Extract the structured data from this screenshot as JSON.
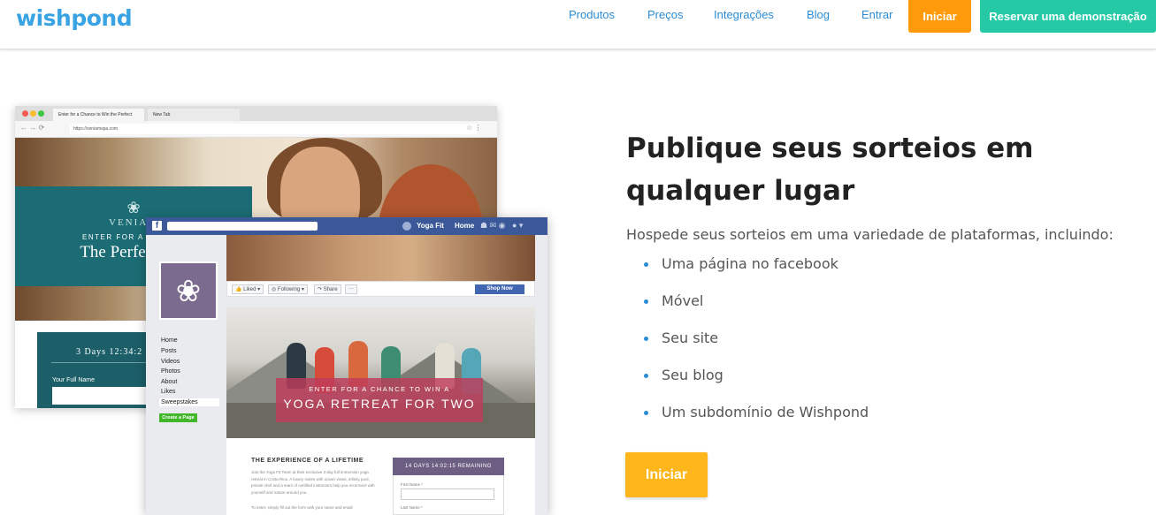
{
  "header": {
    "logo": "wishpond",
    "nav": [
      "Produtos",
      "Preços",
      "Integrações",
      "Blog",
      "Entrar"
    ],
    "start_label": "Iniciar",
    "demo_label": "Reservar uma demonstração"
  },
  "mockup": {
    "browser": {
      "tab1": "Enter for a Chance to Win the Perfect",
      "tab2": "New Tab",
      "url": "https://veniamspa.com",
      "brand": "VENIAM",
      "kicker": "ENTER FOR A CHANCE",
      "headline": "The Perfect Spa",
      "timer": "3 Days 12:34:2",
      "field": "Your Full Name"
    },
    "facebook": {
      "page_name": "Yoga Fit",
      "home": "Home",
      "menu": [
        "Home",
        "Posts",
        "Videos",
        "Photos",
        "About",
        "Likes",
        "Sweepstakes"
      ],
      "create_page": "Create a Page",
      "liked": "Liked",
      "following": "Following",
      "share": "Share",
      "shop": "Shop Now",
      "banner_small": "ENTER FOR A CHANCE TO WIN A",
      "banner_big": "YOGA RETREAT FOR TWO",
      "exp_title": "THE EXPERIENCE OF A LIFETIME",
      "exp_body": "Join the Yoga Fit Team at their exclusive 3-day full immersion yoga retreat in Costa Rica. A luxury suites with ocean views, infinity pool, private chef and a team of certified instructors help you reconnect with yourself and nature around you.",
      "exp_enter": "To enter, simply fill out the form with your name and email",
      "timer": "14 DAYS 14:02:15 REMAINING",
      "first_name": "First Name *",
      "last_name": "Last Name *"
    }
  },
  "content": {
    "title": "Publique seus sorteios em qualquer lugar",
    "lead": "Hospede seus sorteios em uma variedade de plataformas, incluindo:",
    "items": [
      "Uma página no facebook",
      "Móvel",
      "Seu site",
      "Seu blog",
      "Um subdomínio de Wishpond"
    ],
    "cta": "Iniciar"
  },
  "colors": {
    "brand": "#3aa3e3",
    "orange": "#ff9a0a",
    "teal": "#26c9a6",
    "cta": "#ffb61a"
  }
}
